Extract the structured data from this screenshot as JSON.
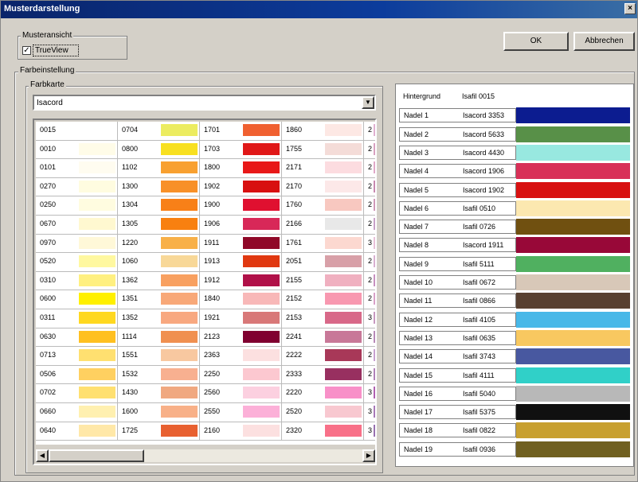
{
  "window": {
    "title": "Musterdarstellung",
    "close": "×"
  },
  "buttons": {
    "ok": "OK",
    "cancel": "Abbrechen"
  },
  "musteransicht": {
    "legend": "Musteransicht",
    "trueview_label": "TrueView",
    "trueview_checked": true,
    "check_mark": "✓"
  },
  "farbeinstellung": {
    "legend": "Farbeinstellung",
    "farbkarte_label": "Farbkarte"
  },
  "farbkarte": {
    "selected": "Isacord",
    "arrow": "▼"
  },
  "scroll": {
    "left_arrow": "◀",
    "right_arrow": "▶"
  },
  "grid": {
    "rows": [
      [
        {
          "code": "0015",
          "color": "#ffffff"
        },
        {
          "code": "0704",
          "color": "#ecec60"
        },
        {
          "code": "1701",
          "color": "#f06030"
        },
        {
          "code": "1860",
          "color": "#fde8e4"
        },
        {
          "code": "2",
          "color": "#e0b0d0"
        }
      ],
      [
        {
          "code": "0010",
          "color": "#fffce8"
        },
        {
          "code": "0800",
          "color": "#f8e020"
        },
        {
          "code": "1703",
          "color": "#e01818"
        },
        {
          "code": "1755",
          "color": "#f4dcd8"
        },
        {
          "code": "2",
          "color": "#d8a0c0"
        }
      ],
      [
        {
          "code": "0101",
          "color": "#fffcf0"
        },
        {
          "code": "1102",
          "color": "#f8a030"
        },
        {
          "code": "1800",
          "color": "#e81818"
        },
        {
          "code": "2171",
          "color": "#fcdce0"
        },
        {
          "code": "2",
          "color": "#e0a8c8"
        }
      ],
      [
        {
          "code": "0270",
          "color": "#fffce0"
        },
        {
          "code": "1300",
          "color": "#f89028"
        },
        {
          "code": "1902",
          "color": "#d81010"
        },
        {
          "code": "2170",
          "color": "#fce8e8"
        },
        {
          "code": "2",
          "color": "#c888b0"
        }
      ],
      [
        {
          "code": "0250",
          "color": "#fffce0"
        },
        {
          "code": "1304",
          "color": "#f88018"
        },
        {
          "code": "1900",
          "color": "#e01030"
        },
        {
          "code": "1760",
          "color": "#f8c8c0"
        },
        {
          "code": "2",
          "color": "#d098b8"
        }
      ],
      [
        {
          "code": "0670",
          "color": "#fff8d0"
        },
        {
          "code": "1305",
          "color": "#f88010"
        },
        {
          "code": "1906",
          "color": "#d82858"
        },
        {
          "code": "2166",
          "color": "#e8e8e8"
        },
        {
          "code": "2",
          "color": "#c8a0c8"
        }
      ],
      [
        {
          "code": "0970",
          "color": "#fff8d8"
        },
        {
          "code": "1220",
          "color": "#f8b048"
        },
        {
          "code": "1911",
          "color": "#900828"
        },
        {
          "code": "1761",
          "color": "#fcd8d0"
        },
        {
          "code": "3",
          "color": "#e8c0d8"
        }
      ],
      [
        {
          "code": "0520",
          "color": "#fff8a0"
        },
        {
          "code": "1060",
          "color": "#f8d898"
        },
        {
          "code": "1913",
          "color": "#e03810"
        },
        {
          "code": "2051",
          "color": "#d8a0a8"
        },
        {
          "code": "2",
          "color": "#d8b0d0"
        }
      ],
      [
        {
          "code": "0310",
          "color": "#fff080"
        },
        {
          "code": "1362",
          "color": "#f8a060"
        },
        {
          "code": "1912",
          "color": "#b01048"
        },
        {
          "code": "2155",
          "color": "#f0b0c0"
        },
        {
          "code": "2",
          "color": "#c890c0"
        }
      ],
      [
        {
          "code": "0600",
          "color": "#fff000"
        },
        {
          "code": "1351",
          "color": "#f8a878"
        },
        {
          "code": "1840",
          "color": "#f8b8b8"
        },
        {
          "code": "2152",
          "color": "#f898b0"
        },
        {
          "code": "2",
          "color": "#d8a0c8"
        }
      ],
      [
        {
          "code": "0311",
          "color": "#ffd820"
        },
        {
          "code": "1352",
          "color": "#f8a880"
        },
        {
          "code": "1921",
          "color": "#d87878"
        },
        {
          "code": "2153",
          "color": "#d86888"
        },
        {
          "code": "3",
          "color": "#c898c0"
        }
      ],
      [
        {
          "code": "0630",
          "color": "#ffc020"
        },
        {
          "code": "1114",
          "color": "#f09050"
        },
        {
          "code": "2123",
          "color": "#800030"
        },
        {
          "code": "2241",
          "color": "#c87898"
        },
        {
          "code": "2",
          "color": "#b888b8"
        }
      ],
      [
        {
          "code": "0713",
          "color": "#ffe070"
        },
        {
          "code": "1551",
          "color": "#f8c8a0"
        },
        {
          "code": "2363",
          "color": "#fce0e0"
        },
        {
          "code": "2222",
          "color": "#a83858"
        },
        {
          "code": "2",
          "color": "#c8a0d0"
        }
      ],
      [
        {
          "code": "0506",
          "color": "#ffd060"
        },
        {
          "code": "1532",
          "color": "#f8b090"
        },
        {
          "code": "2250",
          "color": "#fcc8d0"
        },
        {
          "code": "2333",
          "color": "#983060"
        },
        {
          "code": "2",
          "color": "#b080b8"
        }
      ],
      [
        {
          "code": "0702",
          "color": "#ffe070"
        },
        {
          "code": "1430",
          "color": "#f0a880"
        },
        {
          "code": "2560",
          "color": "#fcd0e0"
        },
        {
          "code": "2220",
          "color": "#f890c8"
        },
        {
          "code": "3",
          "color": "#b060b0"
        }
      ],
      [
        {
          "code": "0660",
          "color": "#fff0b0"
        },
        {
          "code": "1600",
          "color": "#f8b088"
        },
        {
          "code": "2550",
          "color": "#fcb0d8"
        },
        {
          "code": "2520",
          "color": "#f8c8d0"
        },
        {
          "code": "3",
          "color": "#a878b8"
        }
      ],
      [
        {
          "code": "0640",
          "color": "#ffe8a8"
        },
        {
          "code": "1725",
          "color": "#e86030"
        },
        {
          "code": "2160",
          "color": "#fce0e0"
        },
        {
          "code": "2320",
          "color": "#f87088"
        },
        {
          "code": "3",
          "color": "#9870b0"
        }
      ]
    ]
  },
  "needles": {
    "hintergrund": {
      "label": "Hintergrund",
      "thread": "Isafil 0015",
      "color": "#ffffff"
    },
    "items": [
      {
        "label": "Nadel 1",
        "thread": "Isacord 3353",
        "color": "#0c1c90"
      },
      {
        "label": "Nadel 2",
        "thread": "Isacord 5633",
        "color": "#589048"
      },
      {
        "label": "Nadel 3",
        "thread": "Isacord 4430",
        "color": "#98e8e0"
      },
      {
        "label": "Nadel 4",
        "thread": "Isacord 1906",
        "color": "#d83058"
      },
      {
        "label": "Nadel 5",
        "thread": "Isacord 1902",
        "color": "#d81010"
      },
      {
        "label": "Nadel 6",
        "thread": "Isafil 0510",
        "color": "#fce8b0"
      },
      {
        "label": "Nadel 7",
        "thread": "Isafil 0726",
        "color": "#705010"
      },
      {
        "label": "Nadel 8",
        "thread": "Isacord 1911",
        "color": "#980838"
      },
      {
        "label": "Nadel 9",
        "thread": "Isafil 5111",
        "color": "#50b060"
      },
      {
        "label": "Nadel 10",
        "thread": "Isafil 0672",
        "color": "#d8c8b8"
      },
      {
        "label": "Nadel 11",
        "thread": "Isafil 0866",
        "color": "#584030"
      },
      {
        "label": "Nadel 12",
        "thread": "Isafil 4105",
        "color": "#48b8e8"
      },
      {
        "label": "Nadel 13",
        "thread": "Isafil 0635",
        "color": "#f8c860"
      },
      {
        "label": "Nadel 14",
        "thread": "Isafil 3743",
        "color": "#4858a0"
      },
      {
        "label": "Nadel 15",
        "thread": "Isafil 4111",
        "color": "#30d0c8"
      },
      {
        "label": "Nadel 16",
        "thread": "Isafil 5040",
        "color": "#b8b8b8"
      },
      {
        "label": "Nadel 17",
        "thread": "Isafil 5375",
        "color": "#101010"
      },
      {
        "label": "Nadel 18",
        "thread": "Isafil 0822",
        "color": "#c8a030"
      },
      {
        "label": "Nadel 19",
        "thread": "Isafil 0936",
        "color": "#706020"
      }
    ]
  }
}
